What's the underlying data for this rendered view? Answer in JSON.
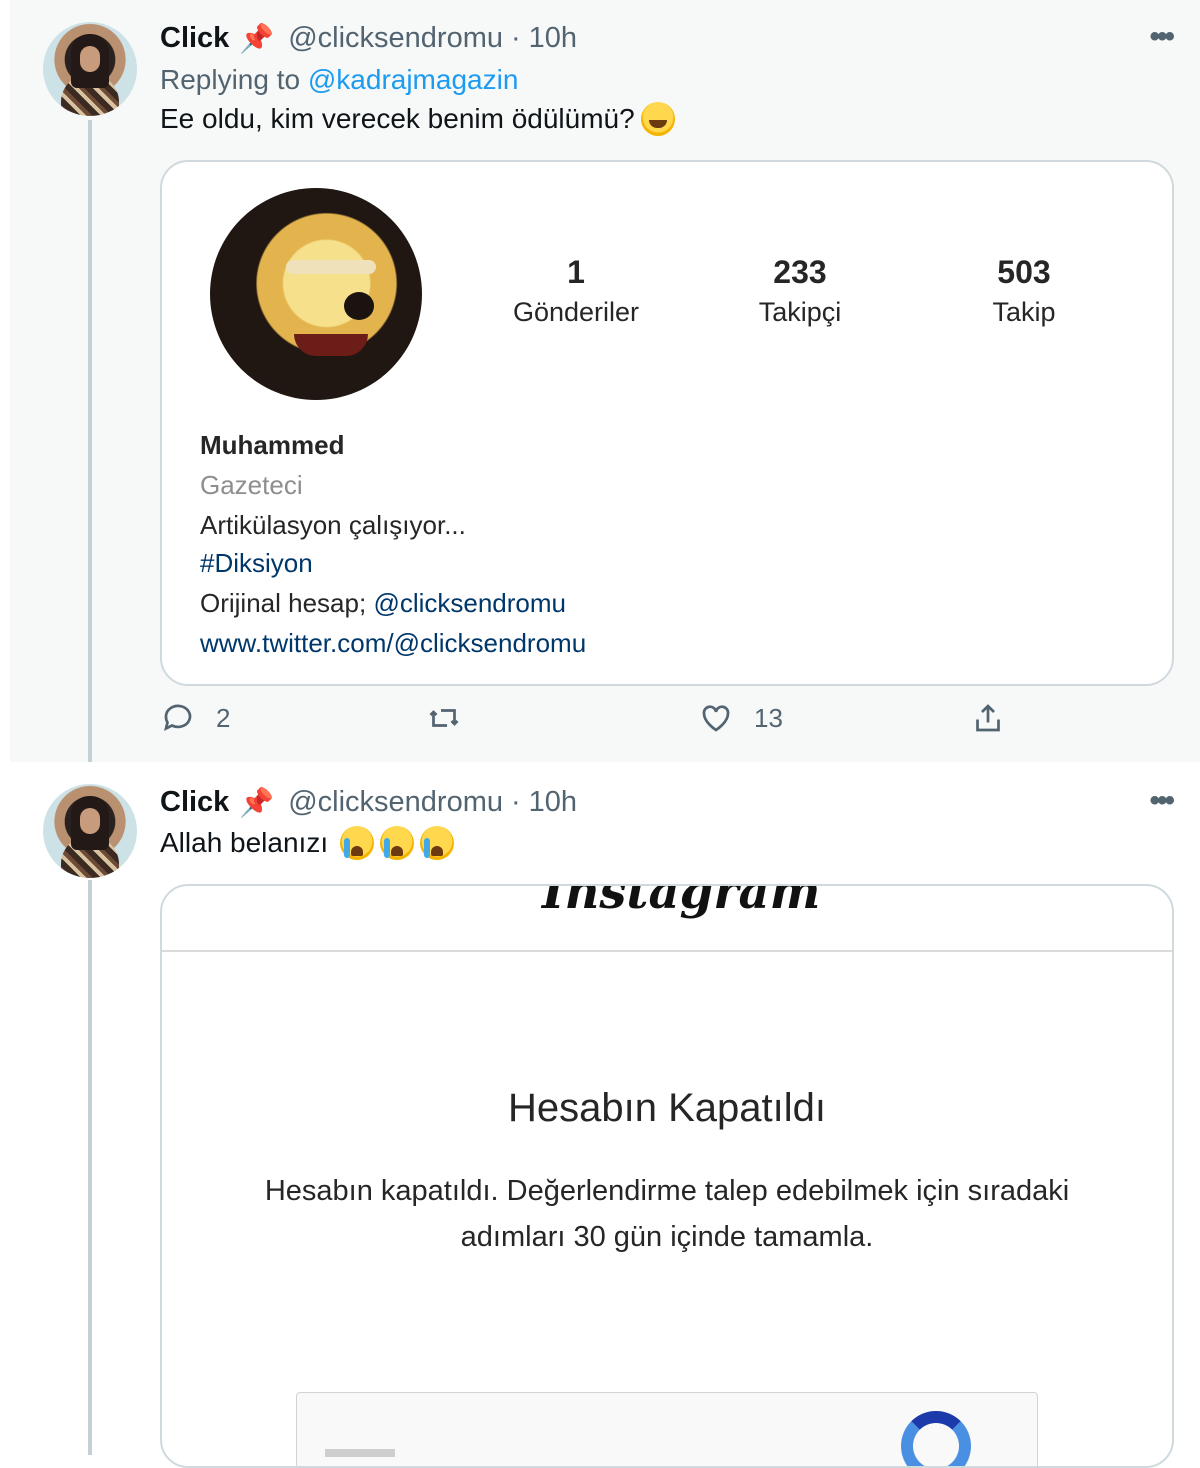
{
  "tweet1": {
    "name": "Click",
    "pin": "📌",
    "handle": "@clicksendromu",
    "dot": "·",
    "time": "10h",
    "more": "•••",
    "replying_prefix": "Replying to",
    "replying_mention": "@kadrajmagazin",
    "text": "Ee oldu, kim verecek benim ödülümü?",
    "emoji": "rolling-on-floor-laughing",
    "card": {
      "stats": [
        {
          "value": "1",
          "label": "Gönderiler"
        },
        {
          "value": "233",
          "label": "Takipçi"
        },
        {
          "value": "503",
          "label": "Takip"
        }
      ],
      "bio_name": "Muhammed",
      "bio_category": "Gazeteci",
      "bio_line1": "Artikülasyon çalışıyor...",
      "bio_hashtag": "#Diksiyon",
      "bio_original_prefix": "Orijinal hesap;",
      "bio_original_handle": "@clicksendromu",
      "bio_link": "www.twitter.com/@clicksendromu"
    },
    "actions": {
      "reply_count": "2",
      "retweet_count": "",
      "like_count": "13"
    }
  },
  "tweet2": {
    "name": "Click",
    "pin": "📌",
    "handle": "@clicksendromu",
    "dot": "·",
    "time": "10h",
    "more": "•••",
    "text": "Allah belanızı",
    "emoji": "loudly-crying-face",
    "card": {
      "logo_text": "Instagram",
      "title": "Hesabın Kapatıldı",
      "message": "Hesabın kapatıldı. Değerlendirme talep edebilmek için sıradaki adımları 30 gün içinde tamamla."
    }
  },
  "colors": {
    "link": "#1d9bf0",
    "ig_link": "#00376b",
    "muted": "#536471",
    "thread_line": "#c4cfd6"
  }
}
